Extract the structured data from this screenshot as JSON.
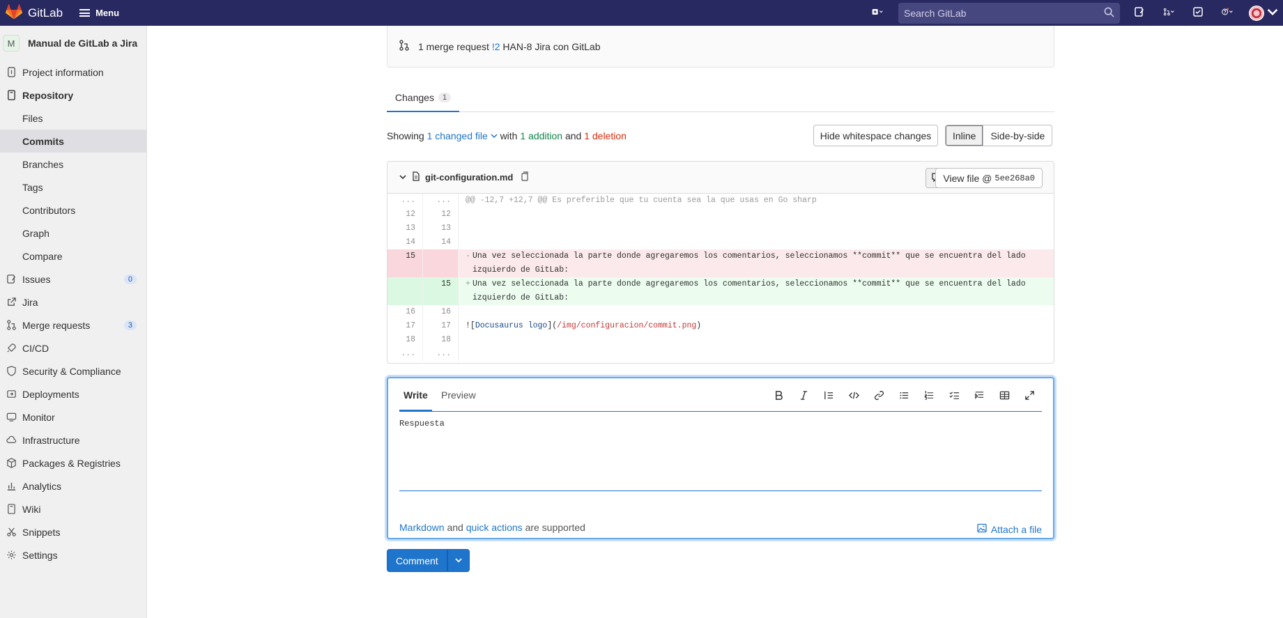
{
  "topbar": {
    "brand": "GitLab",
    "menu_label": "Menu",
    "search_placeholder": "Search GitLab"
  },
  "sidebar": {
    "project_initial": "M",
    "project_name": "Manual de GitLab a Jira",
    "items": [
      {
        "label": "Project information"
      },
      {
        "label": "Repository"
      },
      {
        "label": "Files"
      },
      {
        "label": "Commits"
      },
      {
        "label": "Branches"
      },
      {
        "label": "Tags"
      },
      {
        "label": "Contributors"
      },
      {
        "label": "Graph"
      },
      {
        "label": "Compare"
      },
      {
        "label": "Issues",
        "badge": "0"
      },
      {
        "label": "Jira"
      },
      {
        "label": "Merge requests",
        "badge": "3"
      },
      {
        "label": "CI/CD"
      },
      {
        "label": "Security & Compliance"
      },
      {
        "label": "Deployments"
      },
      {
        "label": "Monitor"
      },
      {
        "label": "Infrastructure"
      },
      {
        "label": "Packages & Registries"
      },
      {
        "label": "Analytics"
      },
      {
        "label": "Wiki"
      },
      {
        "label": "Snippets"
      },
      {
        "label": "Settings"
      }
    ]
  },
  "merge_request": {
    "prefix": "1 merge request",
    "ref": "!2",
    "title": "HAN-8 Jira con GitLab"
  },
  "tabs": {
    "changes_label": "Changes",
    "changes_count": "1"
  },
  "summary": {
    "showing": "Showing",
    "changed": "1 changed file",
    "with": "with",
    "additions": "1 addition",
    "and": "and",
    "deletions": "1 deletion"
  },
  "view_controls": {
    "hide_whitespace": "Hide whitespace changes",
    "inline": "Inline",
    "side_by_side": "Side-by-side"
  },
  "file": {
    "name": "git-configuration.md",
    "view_file_label": "View file @",
    "view_file_sha": "5ee268a0"
  },
  "diff": {
    "hunk": "@@ -12,7 +12,7 @@ Es preferible que tu cuenta sea la que usas en Go sharp",
    "lines": [
      {
        "type": "ctx",
        "old": "12",
        "new": "12",
        "text": ""
      },
      {
        "type": "ctx",
        "old": "13",
        "new": "13",
        "text": ""
      },
      {
        "type": "ctx",
        "old": "14",
        "new": "14",
        "text": ""
      },
      {
        "type": "del",
        "old": "15",
        "new": "",
        "sign": "-",
        "text": "Una vez seleccionada la parte donde agregaremos los comentarios, seleccionamos **commit** que se encuentra del lado izquierdo de GitLab:"
      },
      {
        "type": "add",
        "old": "",
        "new": "15",
        "sign": "+",
        "text": "Una vez seleccionada la parte donde agregaremos los comentarios, seleccionamos **commit** que se encuentra del lado izquierdo de GitLab: "
      },
      {
        "type": "ctx",
        "old": "16",
        "new": "16",
        "text": ""
      },
      {
        "type": "img",
        "old": "17",
        "new": "17",
        "open": "![",
        "alt": "Docusaurus logo",
        "mid": "](",
        "url": "/img/configuracion/commit.png",
        "close": ")"
      },
      {
        "type": "ctx",
        "old": "18",
        "new": "18",
        "text": ""
      }
    ],
    "dots": "..."
  },
  "comment": {
    "write_tab": "Write",
    "preview_tab": "Preview",
    "text": "Respuesta",
    "footer_markdown": "Markdown",
    "footer_and": "and",
    "footer_quick": "quick actions",
    "footer_supported": "are supported",
    "attach": "Attach a file",
    "submit": "Comment"
  },
  "colors": {
    "topbar": "#292961",
    "accent": "#1f75cb",
    "addition": "#108548",
    "deletion": "#dd2b0e"
  }
}
